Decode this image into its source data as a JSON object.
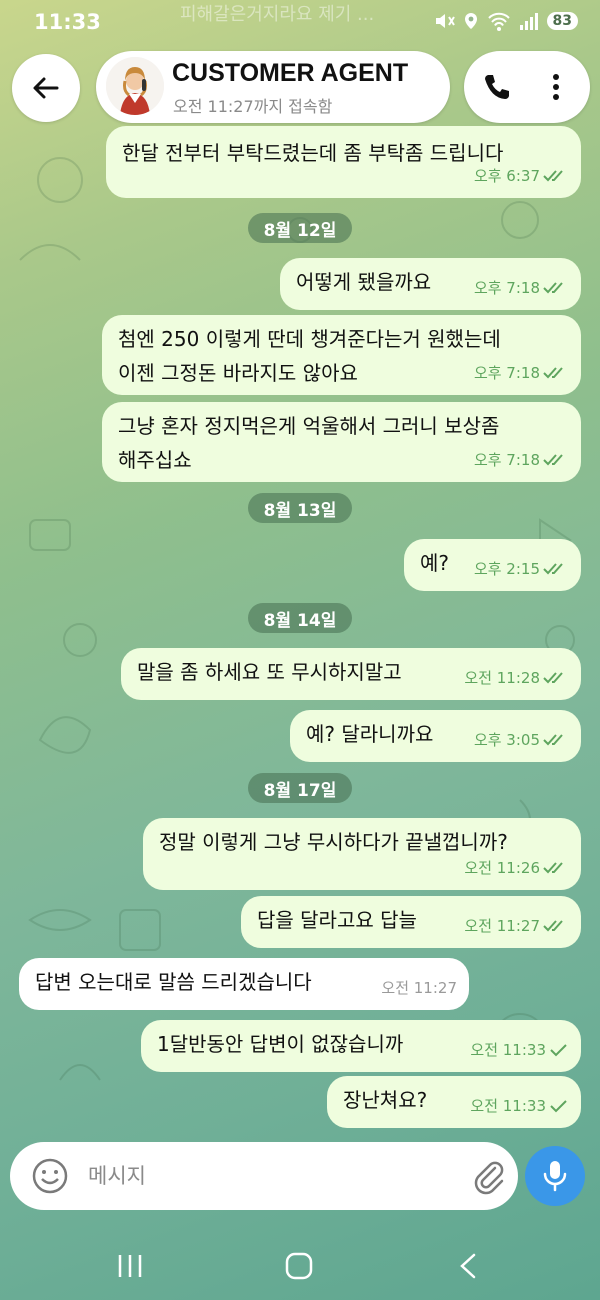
{
  "status_bar": {
    "time": "11:33",
    "battery": "83"
  },
  "header": {
    "ghost_text": "피해갈은거지라요 제기 ...",
    "title": "CUSTOMER AGENT",
    "subtitle": "오전 11:27까지 접속함"
  },
  "messages": [
    {
      "text": "한달 전부터 부탁드렸는데 좀 부탁좀 드립니다",
      "time": "오후 6:37"
    },
    {
      "date": "8월 12일"
    },
    {
      "text": "어떻게 됐을까요",
      "time": "오후 7:18"
    },
    {
      "text": "첨엔 250 이렇게 딴데 챙겨준다는거 원했는데\n이젠 그정돈 바라지도 않아요",
      "time": "오후 7:18"
    },
    {
      "text": "그냥 혼자 정지먹은게 억울해서 그러니 보상좀\n해주십쇼",
      "time": "오후 7:18"
    },
    {
      "date": "8월 13일"
    },
    {
      "text": "예?",
      "time": "오후 2:15"
    },
    {
      "date": "8월 14일"
    },
    {
      "text": "말을 좀 하세요 또 무시하지말고",
      "time": "오전 11:28"
    },
    {
      "text": "예? 달라니까요",
      "time": "오후 3:05"
    },
    {
      "date": "8월 17일"
    },
    {
      "text": "정말 이렇게 그냥 무시하다가 끝낼껍니까?",
      "time": "오전 11:26"
    },
    {
      "text": "답을 달라고요 답늘",
      "time": "오전 11:27"
    },
    {
      "text": "답변 오는대로 말씀 드리겠습니다",
      "time": "오전 11:27"
    },
    {
      "text": "1달반동안 답변이 없잖습니까",
      "time": "오전 11:33"
    },
    {
      "text": "장난쳐요?",
      "time": "오전 11:33"
    }
  ],
  "input": {
    "placeholder": "메시지"
  },
  "colors": {
    "outgoing_bubble": "#effdde",
    "incoming_bubble": "#ffffff",
    "check_green": "#5ea55e",
    "mic_blue": "#3a97e8"
  },
  "icons": [
    "back-arrow-icon",
    "phone-icon",
    "more-vertical-icon",
    "emoji-icon",
    "paperclip-icon",
    "microphone-icon",
    "double-check-icon",
    "single-check-icon",
    "recents-icon",
    "home-icon",
    "back-nav-icon"
  ]
}
